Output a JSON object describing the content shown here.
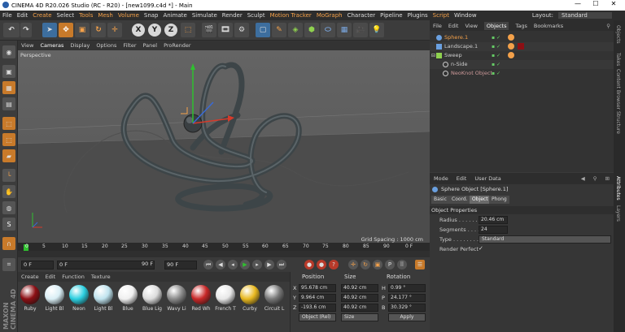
{
  "window": {
    "title": "CINEMA 4D R20.026 Studio (RC - R20) - [new1099.c4d *] - Main",
    "min": "—",
    "max": "☐",
    "close": "✕"
  },
  "menu": [
    "File",
    "Edit",
    "Create",
    "Select",
    "Tools",
    "Mesh",
    "Volume",
    "Snap",
    "Animate",
    "Simulate",
    "Render",
    "Sculpt",
    "Motion Tracker",
    "MoGraph",
    "Character",
    "Pipeline",
    "Plugins",
    "Script",
    "Window"
  ],
  "layout": {
    "label": "Layout:",
    "value": "Standard"
  },
  "toolbar": {
    "x": "X",
    "y": "Y",
    "z": "Z"
  },
  "viewport": {
    "menu": [
      "View",
      "Cameras",
      "Display",
      "Options",
      "Filter",
      "Panel",
      "ProRender"
    ],
    "label": "Perspective",
    "grid_spacing": "Grid Spacing : 1000 cm"
  },
  "timeline": {
    "ticks": [
      "0",
      "5",
      "10",
      "15",
      "20",
      "25",
      "30",
      "35",
      "40",
      "45",
      "50",
      "55",
      "60",
      "65",
      "70",
      "75",
      "80",
      "85",
      "90"
    ],
    "end_label": "0 F",
    "cur_frame": "0 F",
    "start": "0 F",
    "max_field": "90 F",
    "max2": "90 F"
  },
  "materials": {
    "menu": [
      "Create",
      "Edit",
      "Function",
      "Texture"
    ],
    "items": [
      {
        "name": "Ruby",
        "color": "#8c0f14"
      },
      {
        "name": "Light Bl",
        "color": "#d9eef5"
      },
      {
        "name": "Neon",
        "color": "#2ccfe0"
      },
      {
        "name": "Light Bl",
        "color": "#bfe3ee"
      },
      {
        "name": "Blue",
        "color": "#f0f0f0"
      },
      {
        "name": "Blue Lig",
        "color": "#dcdcdc"
      },
      {
        "name": "Wavy Li",
        "color": "#8a8a8a"
      },
      {
        "name": "Red Wh",
        "color": "#c82828"
      },
      {
        "name": "French T",
        "color": "#e8e8e8"
      },
      {
        "name": "Curby",
        "color": "#e8b820"
      },
      {
        "name": "Circuit L",
        "color": "#777777"
      }
    ]
  },
  "coords": {
    "headers": [
      "Position",
      "Size",
      "Rotation"
    ],
    "rows": [
      {
        "axis": "X",
        "pos": "95.678 cm",
        "size": "40.92 cm",
        "rl": "H",
        "rot": "0.99 °"
      },
      {
        "axis": "Y",
        "pos": "9.964 cm",
        "size": "40.92 cm",
        "rl": "P",
        "rot": "24.177 °"
      },
      {
        "axis": "Z",
        "pos": "-193.6 cm",
        "size": "40.92 cm",
        "rl": "B",
        "rot": "30.329 °"
      }
    ],
    "mode": "Object (Rel)",
    "size_mode": "Size",
    "apply": "Apply"
  },
  "objects": {
    "tabs": [
      "File",
      "Edit",
      "View",
      "Objects",
      "Tags",
      "Bookmarks"
    ],
    "items": [
      {
        "name": "Sphere.1",
        "indent": 0,
        "color": "#f4a14a"
      },
      {
        "name": "Landscape.1",
        "indent": 0,
        "color": "#ccc"
      },
      {
        "name": "Sweep",
        "indent": 0,
        "color": "#ccc"
      },
      {
        "name": "n-Side",
        "indent": 1,
        "color": "#ccc"
      },
      {
        "name": "NeoKnot Object",
        "indent": 1,
        "color": "#ccc"
      }
    ]
  },
  "attributes": {
    "menu": [
      "Mode",
      "Edit",
      "User Data"
    ],
    "object_title": "Sphere Object [Sphere.1]",
    "tabs": [
      "Basic",
      "Coord.",
      "Object",
      "Phong"
    ],
    "active_tab": "Object",
    "section": "Object Properties",
    "radius_label": "Radius . . . . . . .",
    "radius": "20.46 cm",
    "segments_label": "Segments . . . .",
    "segments": "24",
    "type_label": "Type . . . . . . . . .",
    "type": "Standard",
    "render_label": "Render Perfect",
    "render_check": "✓"
  },
  "sidestrip": [
    "Objects",
    "Takes",
    "Content Browser",
    "Structure",
    "Attributes",
    "Layers"
  ],
  "logo": "MAXON CINEMA 4D"
}
